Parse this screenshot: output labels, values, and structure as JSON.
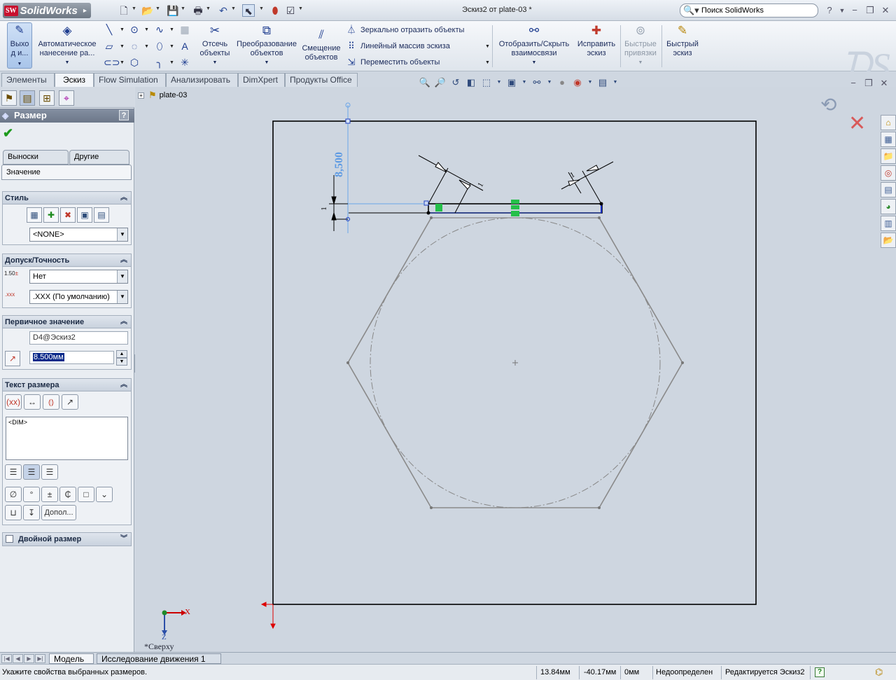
{
  "app": {
    "logo_badge": "SW",
    "logo_text": "SolidWorks",
    "document_title": "Эскиз2 от plate-03 *",
    "search_placeholder": "Поиск SolidWorks"
  },
  "command_manager": {
    "exit_sketch": "Выхо\nд и...",
    "smart_dimension": "Автоматическое\nнанесение ра...",
    "trim": "Отсечь\nобъекты",
    "convert": "Преобразование\nобъектов",
    "offset": "Смещение\nобъектов",
    "mirror": "Зеркально отразить объекты",
    "linear_pattern": "Линейный массив эскиза",
    "move": "Переместить объекты",
    "display_relations": "Отобразить/Скрыть\nвзаимосвязи",
    "repair_sketch": "Исправить\nэскиз",
    "quick_snaps": "Быстрые\nпривязки",
    "rapid_sketch": "Быстрый\nэскиз"
  },
  "tabs": [
    {
      "label": "Элементы",
      "active": false
    },
    {
      "label": "Эскиз",
      "active": true
    },
    {
      "label": "Flow Simulation",
      "active": false
    },
    {
      "label": "Анализировать",
      "active": false
    },
    {
      "label": "DimXpert",
      "active": false
    },
    {
      "label": "Продукты Office",
      "active": false
    }
  ],
  "property_manager": {
    "title": "Размер",
    "help": "?",
    "subtabs": {
      "leaders": "Выноски",
      "other": "Другие",
      "value": "Значение"
    },
    "style": {
      "header": "Стиль",
      "combo_value": "<NONE>"
    },
    "tolerance": {
      "header": "Допуск/Точность",
      "tolerance_value": "Нет",
      "precision_value": ".XXX (По умолчанию)"
    },
    "primary_value": {
      "header": "Первичное значение",
      "name": "D4@Эскиз2",
      "value": "8.500мм"
    },
    "dim_text": {
      "header": "Текст размера",
      "text": "<DIM>",
      "more_button": "Допол..."
    },
    "dual_dimension": {
      "header": "Двойной размер"
    }
  },
  "feature_tree": {
    "part_name": "plate-03"
  },
  "graphics": {
    "view_label": "*Сверху",
    "dimension_value": "8,500",
    "dim_small_1": "1",
    "dim_small_2": "1",
    "dim_small_3": "1",
    "axis_x": "X",
    "axis_z": "Z"
  },
  "bottom_tabs": {
    "model": "Модель",
    "motion": "Исследование движения 1"
  },
  "status": {
    "message": "Укажите свойства выбранных размеров.",
    "x": "13.84мм",
    "y": "-40.17мм",
    "z": "0мм",
    "state": "Недоопределен",
    "editing": "Редактируется Эскиз2",
    "help": "?"
  }
}
